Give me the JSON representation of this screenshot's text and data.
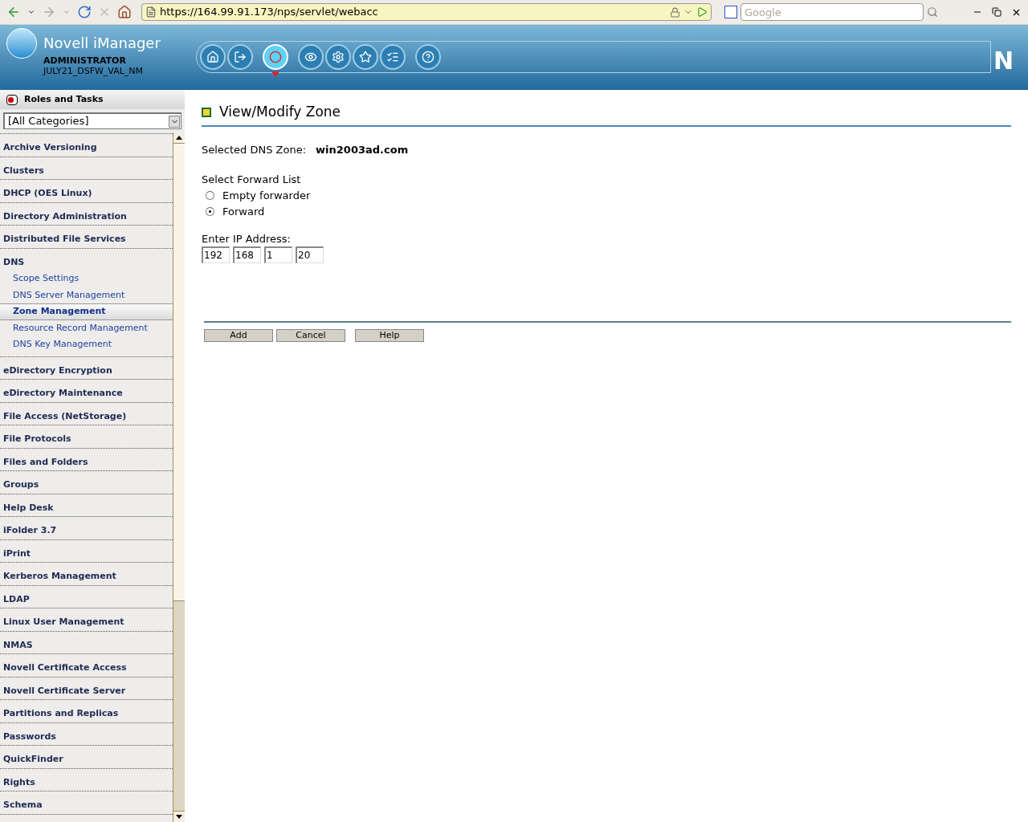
{
  "browser": {
    "url": "https://164.99.91.173/nps/servlet/webacc",
    "search_placeholder": "Google"
  },
  "header": {
    "title": "Novell iManager",
    "user": "ADMINISTRATOR",
    "tree": "JULY21_DSFW_VAL_NM",
    "logo_letter": "N",
    "toolbar": [
      {
        "kind": "home",
        "selected": false
      },
      {
        "kind": "exit",
        "selected": false
      },
      {
        "kind": "roles",
        "selected": true
      },
      {
        "kind": "view",
        "selected": false
      },
      {
        "kind": "configure",
        "selected": false
      },
      {
        "kind": "favorites",
        "selected": false
      },
      {
        "kind": "tasks",
        "selected": false
      },
      {
        "kind": "help",
        "selected": false
      }
    ]
  },
  "sidebar": {
    "title": "Roles and Tasks",
    "category_select": "[All Categories]",
    "categories": [
      {
        "label": "Archive Versioning"
      },
      {
        "label": "Clusters"
      },
      {
        "label": "DHCP (OES Linux)"
      },
      {
        "label": "Directory Administration"
      },
      {
        "label": "Distributed File Services"
      },
      {
        "label": "DNS",
        "children": [
          {
            "label": "Scope Settings",
            "selected": false
          },
          {
            "label": "DNS Server Management",
            "selected": false
          },
          {
            "label": "Zone Management",
            "selected": true
          },
          {
            "label": "Resource Record Management",
            "selected": false
          },
          {
            "label": "DNS Key Management",
            "selected": false
          }
        ]
      },
      {
        "label": "eDirectory Encryption"
      },
      {
        "label": "eDirectory Maintenance"
      },
      {
        "label": "File Access (NetStorage)"
      },
      {
        "label": "File Protocols"
      },
      {
        "label": "Files and Folders"
      },
      {
        "label": "Groups"
      },
      {
        "label": "Help Desk"
      },
      {
        "label": "iFolder 3.7"
      },
      {
        "label": "iPrint"
      },
      {
        "label": "Kerberos Management"
      },
      {
        "label": "LDAP"
      },
      {
        "label": "Linux User Management"
      },
      {
        "label": "NMAS"
      },
      {
        "label": "Novell Certificate Access"
      },
      {
        "label": "Novell Certificate Server"
      },
      {
        "label": "Partitions and Replicas"
      },
      {
        "label": "Passwords"
      },
      {
        "label": "QuickFinder"
      },
      {
        "label": "Rights"
      },
      {
        "label": "Schema"
      }
    ]
  },
  "main": {
    "title": "View/Modify Zone",
    "zone_label": "Selected DNS Zone:",
    "zone_value": "win2003ad.com",
    "forward_label": "Select Forward List",
    "forward_options": [
      {
        "label": "Empty forwarder",
        "selected": false
      },
      {
        "label": "Forward",
        "selected": true
      }
    ],
    "ip_label": "Enter IP Address:",
    "ip_octets": [
      "192",
      "168",
      "1",
      "20"
    ],
    "buttons": [
      "Add",
      "Cancel",
      "Help"
    ]
  }
}
